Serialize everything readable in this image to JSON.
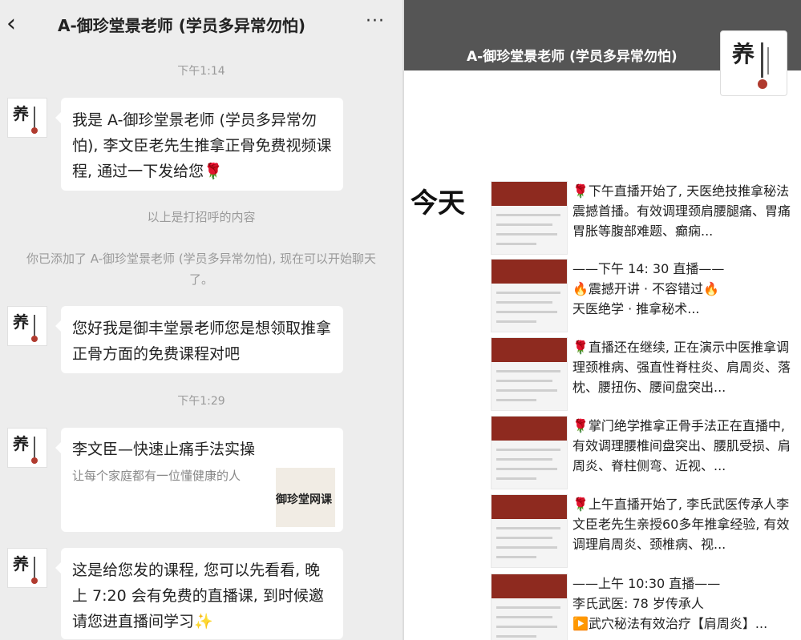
{
  "chat": {
    "title": "A-御珍堂景老师 (学员多异常勿怕)",
    "back_icon": "‹",
    "more_icon": "···",
    "time1": "下午1:14",
    "msg1": "我是 A-御珍堂景老师 (学员多异常勿怕), 李文臣老先生推拿正骨免费视频课程, 通过一下发给您🌹",
    "sys1": "以上是打招呼的内容",
    "sys2": "你已添加了 A-御珍堂景老师 (学员多异常勿怕), 现在可以开始聊天了。",
    "msg2": "您好我是御丰堂景老师您是想领取推拿正骨方面的免费课程对吧",
    "time2": "下午1:29",
    "card": {
      "title": "李文臣—快速止痛手法实操",
      "desc": "让每个家庭都有一位懂健康的人",
      "thumb_text": "御珍堂网课"
    },
    "msg3": "这是给您发的课程, 您可以先看看, 晚上 7:20 会有免费的直播课, 到时候邀请您进直播间学习✨",
    "avatar_char": "养"
  },
  "channel": {
    "title": "A-御珍堂景老师 (学员多异常勿怕)",
    "logo_char": "养",
    "today": "今天",
    "items": [
      {
        "text": "🌹下午直播开始了, 天医绝技推拿秘法震撼首播。有效调理颈肩腰腿痛、胃痛胃胀等腹部难题、癫痫..."
      },
      {
        "text": "——下午 14: 30 直播——\n🔥震撼开讲 · 不容错过🔥\n天医绝学 · 推拿秘术..."
      },
      {
        "text": "🌹直播还在继续, 正在演示中医推拿调理颈椎病、强直性脊柱炎、肩周炎、落枕、腰扭伤、腰间盘突出..."
      },
      {
        "text": "🌹掌门绝学推拿正骨手法正在直播中, 有效调理腰椎间盘突出、腰肌受损、肩周炎、脊柱侧弯、近视、..."
      },
      {
        "text": "🌹上午直播开始了, 李氏武医传承人李文臣老先生亲授60多年推拿经验, 有效调理肩周炎、颈椎病、视..."
      },
      {
        "text": "——上午 10:30 直播——\n李氏武医: 78 岁传承人\n▶️武穴秘法有效治疗【肩周炎】..."
      }
    ]
  },
  "colors": {
    "chat_bg": "#ededed",
    "header_gray": "#555555",
    "accent_red": "#c0392b"
  }
}
